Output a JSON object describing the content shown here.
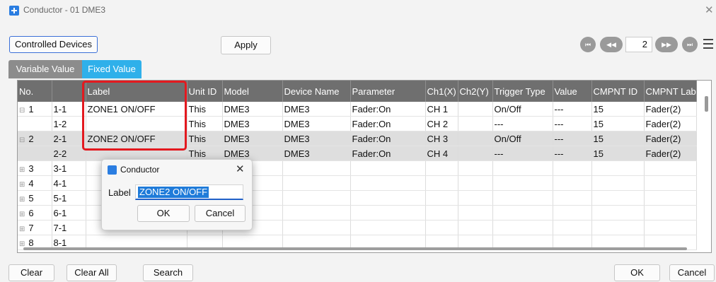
{
  "window": {
    "title": "Conductor - 01 DME3"
  },
  "toolbar": {
    "controlled_devices_label": "Controlled Devices",
    "apply_label": "Apply",
    "page_value": "2",
    "nav_first": "⏮",
    "nav_prev": "◀◀",
    "nav_next": "▶▶",
    "nav_last": "⏭"
  },
  "tabs": {
    "variable": "Variable Value",
    "fixed": "Fixed Value"
  },
  "table": {
    "headers": [
      "No.",
      "",
      "Label",
      "Unit ID",
      "Model",
      "Device Name",
      "Parameter",
      "Ch1(X)",
      "Ch2(Y)",
      "Trigger Type",
      "Value",
      "CMPNT ID",
      "CMPNT Lab"
    ],
    "rows": [
      [
        "1",
        "1-1",
        "ZONE1 ON/OFF",
        "This",
        "DME3",
        "DME3",
        "Fader:On",
        "CH 1",
        "",
        "On/Off",
        "---",
        "15",
        "Fader(2)"
      ],
      [
        "",
        "1-2",
        "",
        "This",
        "DME3",
        "DME3",
        "Fader:On",
        "CH 2",
        "",
        "---",
        "---",
        "15",
        "Fader(2)"
      ],
      [
        "2",
        "2-1",
        "ZONE2 ON/OFF",
        "This",
        "DME3",
        "DME3",
        "Fader:On",
        "CH 3",
        "",
        "On/Off",
        "---",
        "15",
        "Fader(2)"
      ],
      [
        "",
        "2-2",
        "",
        "This",
        "DME3",
        "DME3",
        "Fader:On",
        "CH 4",
        "",
        "---",
        "---",
        "15",
        "Fader(2)"
      ],
      [
        "3",
        "3-1",
        "",
        "",
        "",
        "",
        "",
        "",
        "",
        "",
        "",
        "",
        ""
      ],
      [
        "4",
        "4-1",
        "",
        "",
        "",
        "",
        "",
        "",
        "",
        "",
        "",
        "",
        ""
      ],
      [
        "5",
        "5-1",
        "",
        "",
        "",
        "",
        "",
        "",
        "",
        "",
        "",
        "",
        ""
      ],
      [
        "6",
        "6-1",
        "",
        "",
        "",
        "",
        "",
        "",
        "",
        "",
        "",
        "",
        ""
      ],
      [
        "7",
        "7-1",
        "",
        "",
        "",
        "",
        "",
        "",
        "",
        "",
        "",
        "",
        ""
      ],
      [
        "8",
        "8-1",
        "",
        "",
        "",
        "",
        "",
        "",
        "",
        "",
        "",
        "",
        ""
      ]
    ]
  },
  "dialog": {
    "title": "Conductor",
    "label": "Label",
    "value": "ZONE2 ON/OFF",
    "ok": "OK",
    "cancel": "Cancel"
  },
  "footer": {
    "clear": "Clear",
    "clear_all": "Clear All",
    "search": "Search",
    "ok": "OK",
    "cancel": "Cancel"
  },
  "colors": {
    "accent": "#2fb0ea",
    "highlight": "#e3191f",
    "header_bg": "#6f6f6f"
  }
}
